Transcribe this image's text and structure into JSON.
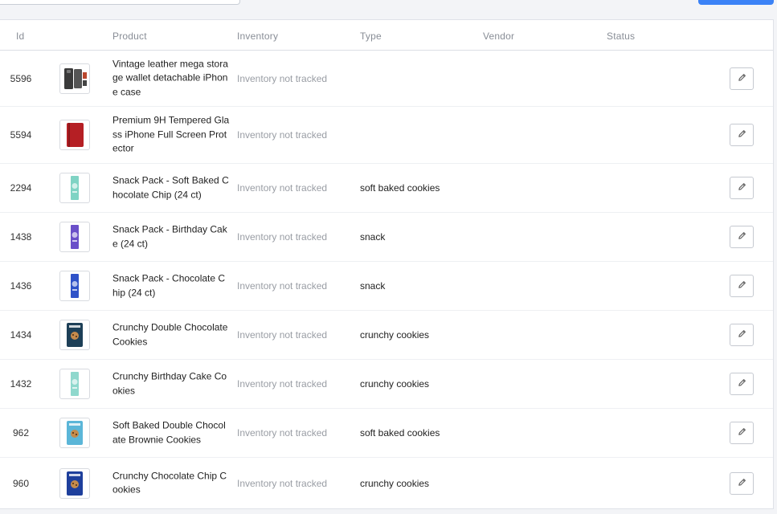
{
  "header": {
    "columns": [
      "Id",
      "Product",
      "Inventory",
      "Type",
      "Vendor",
      "Status"
    ]
  },
  "rows": [
    {
      "id": "5596",
      "product": "Vintage leather mega storage wallet detachable iPhone case",
      "inventory": "Inventory not tracked",
      "type": "",
      "thumb": "phone-wallet",
      "thumb_color": "#3a3a3a"
    },
    {
      "id": "5594",
      "product": "Premium 9H Tempered Glass iPhone Full Screen Protector",
      "inventory": "Inventory not tracked",
      "type": "",
      "thumb": "red-case",
      "thumb_color": "#b51f24"
    },
    {
      "id": "2294",
      "product": "Snack Pack - Soft Baked Chocolate Chip (24 ct)",
      "inventory": "Inventory not tracked",
      "type": "soft baked cookies",
      "thumb": "snack-bar",
      "thumb_color": "#7fd3c4"
    },
    {
      "id": "1438",
      "product": "Snack Pack - Birthday Cake (24 ct)",
      "inventory": "Inventory not tracked",
      "type": "snack",
      "thumb": "snack-bar",
      "thumb_color": "#6a4fc9"
    },
    {
      "id": "1436",
      "product": "Snack Pack - Chocolate Chip (24 ct)",
      "inventory": "Inventory not tracked",
      "type": "snack",
      "thumb": "snack-bar",
      "thumb_color": "#2f52c8"
    },
    {
      "id": "1434",
      "product": "Crunchy Double Chocolate Cookies",
      "inventory": "Inventory not tracked",
      "type": "crunchy cookies",
      "thumb": "cookie-pouch",
      "thumb_color": "#1d3f57"
    },
    {
      "id": "1432",
      "product": "Crunchy Birthday Cake Cookies",
      "inventory": "Inventory not tracked",
      "type": "crunchy cookies",
      "thumb": "snack-bar",
      "thumb_color": "#8fd8cd"
    },
    {
      "id": "962",
      "product": "Soft Baked Double Chocolate Brownie Cookies",
      "inventory": "Inventory not tracked",
      "type": "soft baked cookies",
      "thumb": "cookie-pouch",
      "thumb_color": "#5bb6d8"
    },
    {
      "id": "960",
      "product": "Crunchy Chocolate Chip Cookies",
      "inventory": "Inventory not tracked",
      "type": "crunchy cookies",
      "thumb": "cookie-pouch",
      "thumb_color": "#1e3f9c"
    }
  ],
  "icons": {
    "edit": "pencil-icon"
  },
  "colors": {
    "accent": "#3b82f6",
    "muted_text": "#999da4",
    "border": "#dfe2e8"
  }
}
